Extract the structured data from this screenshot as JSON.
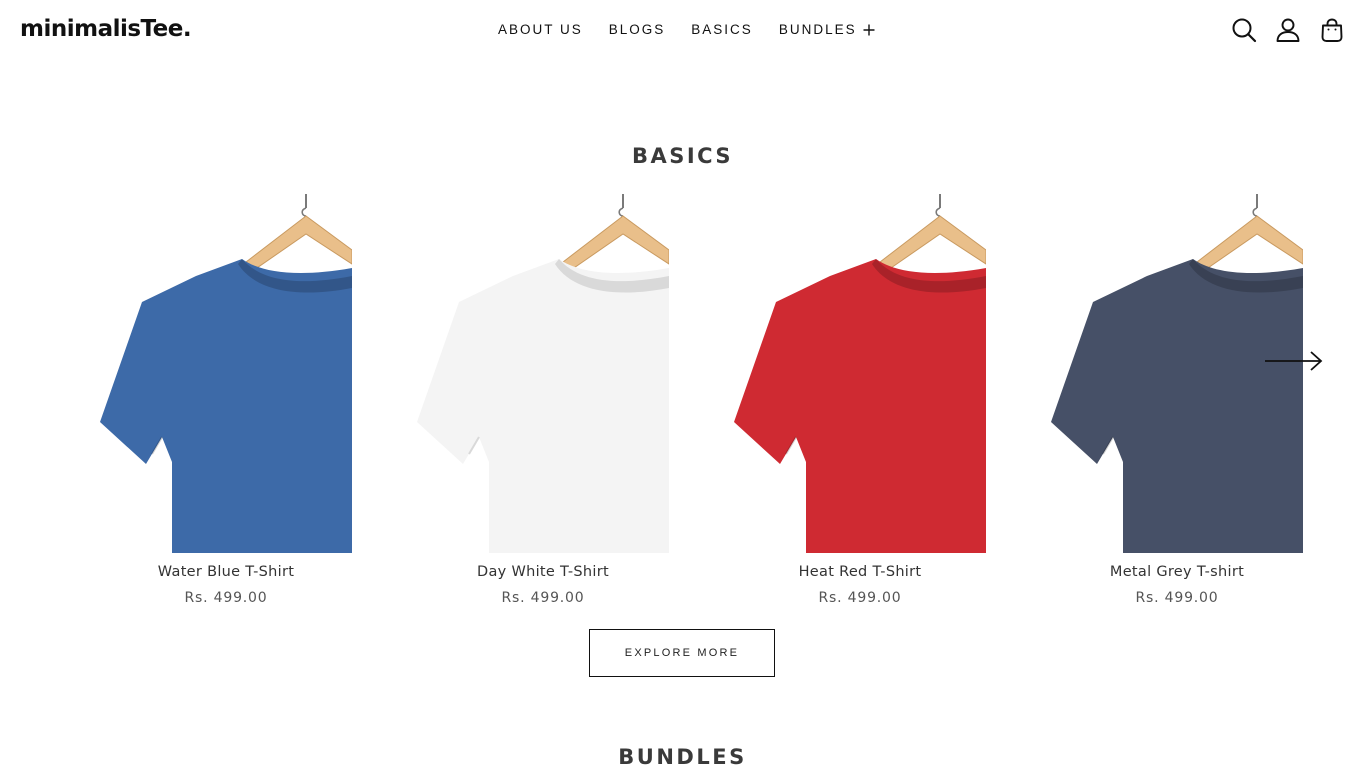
{
  "header": {
    "logo": "minimalisTee.",
    "nav": [
      {
        "label": "ABOUT US"
      },
      {
        "label": "BLOGS"
      },
      {
        "label": "BASICS"
      },
      {
        "label": "BUNDLES",
        "expand_icon": "plus-icon"
      }
    ],
    "icons": [
      "search-icon",
      "account-icon",
      "cart-icon"
    ]
  },
  "sections": {
    "basics_title": "BASICS",
    "bundles_title": "BUNDLES"
  },
  "products": [
    {
      "name": "Water Blue T-Shirt",
      "price": "Rs. 499.00",
      "color": "#3d6aa8"
    },
    {
      "name": "Day White T-Shirt",
      "price": "Rs. 499.00",
      "color": "#f4f4f4"
    },
    {
      "name": "Heat Red T-Shirt",
      "price": "Rs. 499.00",
      "color": "#cf2a32"
    },
    {
      "name": "Metal Grey T-shirt",
      "price": "Rs. 499.00",
      "color": "#465067"
    }
  ],
  "carousel": {
    "next_icon": "arrow-right-icon"
  },
  "explore_button": "EXPLORE MORE"
}
